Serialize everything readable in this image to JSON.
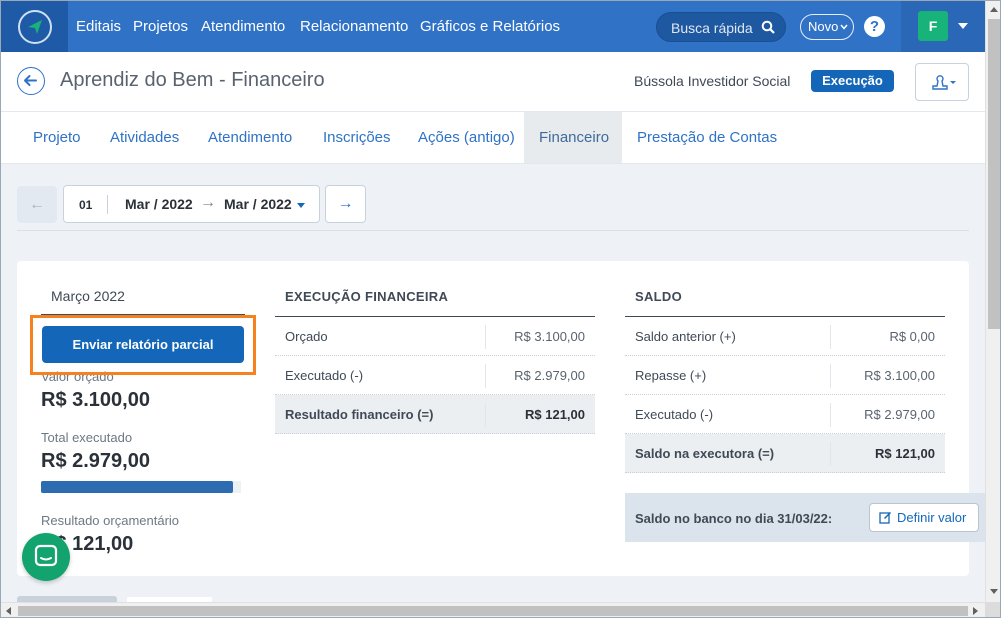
{
  "nav": {
    "links": [
      "Editais",
      "Projetos",
      "Atendimento",
      "Relacionamento",
      "Gráficos e Relatórios"
    ],
    "search_placeholder": "Busca rápida",
    "new_label": "Novo",
    "help_label": "?",
    "avatar_initial": "F"
  },
  "header": {
    "title": "Aprendiz do Bem - Financeiro",
    "organization": "Bússola Investidor Social",
    "status_badge": "Execução"
  },
  "tabs": [
    {
      "label": "Projeto",
      "active": false
    },
    {
      "label": "Atividades",
      "active": false
    },
    {
      "label": "Atendimento",
      "active": false
    },
    {
      "label": "Inscrições",
      "active": false
    },
    {
      "label": "Ações (antigo)",
      "active": false
    },
    {
      "label": "Financeiro",
      "active": true
    },
    {
      "label": "Prestação de Contas",
      "active": false
    }
  ],
  "period": {
    "number": "01",
    "from": "Mar / 2022",
    "to": "Mar / 2022"
  },
  "summary": {
    "month": "Março 2022",
    "send_button": "Enviar relatório parcial",
    "budget_label": "Valor orçado",
    "budget_value": "R$ 3.100,00",
    "executed_label": "Total executado",
    "executed_value": "R$ 2.979,00",
    "executed_progress_pct": 96,
    "result_label": "Resultado orçamentário",
    "result_value": "R$ 121,00"
  },
  "execucao": {
    "title": "EXECUÇÃO FINANCEIRA",
    "rows": [
      {
        "label": "Orçado",
        "value": "R$ 3.100,00"
      },
      {
        "label": "Executado (-)",
        "value": "R$ 2.979,00"
      },
      {
        "label": "Resultado financeiro (=)",
        "value": "R$ 121,00",
        "total": true
      }
    ]
  },
  "saldo": {
    "title": "SALDO",
    "rows": [
      {
        "label": "Saldo anterior (+)",
        "value": "R$ 0,00"
      },
      {
        "label": "Repasse (+)",
        "value": "R$ 3.100,00"
      },
      {
        "label": "Executado (-)",
        "value": "R$ 2.979,00"
      },
      {
        "label": "Saldo na executora (=)",
        "value": "R$ 121,00",
        "total": true
      }
    ],
    "bank_label": "Saldo no banco no dia 31/03/22:",
    "define_button": "Definir valor"
  },
  "colors": {
    "nav_bg": "#2f72c6",
    "primary": "#1467b8",
    "highlight": "#f5821f",
    "chat": "#13a36e",
    "avatar": "#18b37a"
  }
}
